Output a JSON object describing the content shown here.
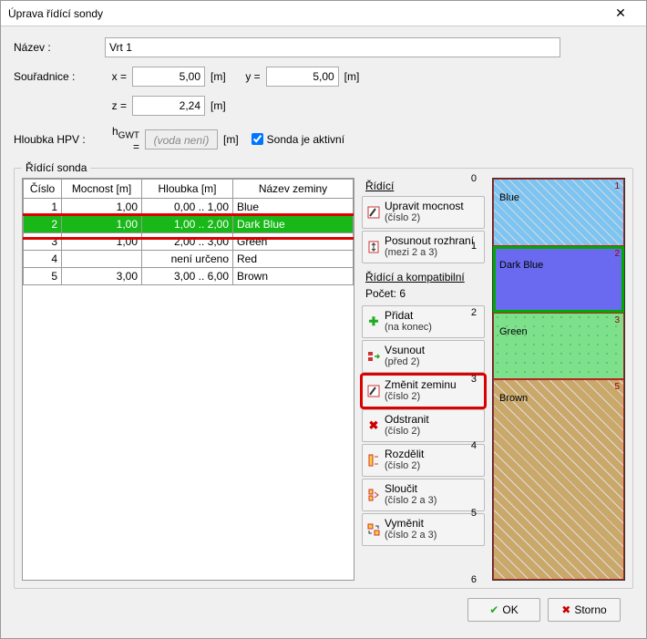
{
  "dialog": {
    "title": "Úprava řídící sondy"
  },
  "form": {
    "name_label": "Název :",
    "name_value": "Vrt 1",
    "coords_label": "Souřadnice :",
    "x_label": "x =",
    "x_value": "5,00",
    "x_unit": "[m]",
    "y_label": "y =",
    "y_value": "5,00",
    "y_unit": "[m]",
    "z_label": "z =",
    "z_value": "2,24",
    "z_unit": "[m]",
    "depth_label": "Hloubka HPV :",
    "hgwt_label": "hGWT =",
    "hgwt_placeholder": "(voda není)",
    "hgwt_unit": "[m]",
    "active_label": "Sonda je aktivní",
    "active_checked": true
  },
  "fieldset": {
    "legend": "Řídící sonda"
  },
  "table": {
    "headers": [
      "Číslo",
      "Mocnost [m]",
      "Hloubka [m]",
      "Název zeminy"
    ],
    "rows": [
      {
        "n": "1",
        "thick": "1,00",
        "depth": "0,00 .. 1,00",
        "soil": "Blue",
        "sel": false
      },
      {
        "n": "2",
        "thick": "1,00",
        "depth": "1,00 .. 2,00",
        "soil": "Dark Blue",
        "sel": true
      },
      {
        "n": "3",
        "thick": "1,00",
        "depth": "2,00 .. 3,00",
        "soil": "Green",
        "sel": false
      },
      {
        "n": "4",
        "thick": "",
        "depth": "není určeno",
        "soil": "Red",
        "sel": false
      },
      {
        "n": "5",
        "thick": "3,00",
        "depth": "3,00 .. 6,00",
        "soil": "Brown",
        "sel": false
      }
    ]
  },
  "actions": {
    "section_ridiçi": "Řídící",
    "upravit": {
      "label": "Upravit mocnost",
      "sub": "(číslo 2)"
    },
    "posunout": {
      "label": "Posunout rozhraní",
      "sub": "(mezi 2 a 3)"
    },
    "section_ridicikomp": "Řídící a kompatibilní",
    "count_label": "Počet: 6",
    "pridat": {
      "label": "Přidat",
      "sub": "(na konec)"
    },
    "vsunout": {
      "label": "Vsunout",
      "sub": "(před 2)"
    },
    "zmenit": {
      "label": "Změnit zeminu",
      "sub": "(číslo 2)"
    },
    "odstranit": {
      "label": "Odstranit",
      "sub": "(číslo 2)"
    },
    "rozdelit": {
      "label": "Rozdělit",
      "sub": "(číslo 2)"
    },
    "sloucit": {
      "label": "Sloučit",
      "sub": "(číslo 2 a 3)"
    },
    "vymenit": {
      "label": "Vyměnit",
      "sub": "(číslo 2 a 3)"
    }
  },
  "viz": {
    "scale": [
      "0",
      "1",
      "2",
      "3",
      "4",
      "5",
      "6"
    ],
    "layers": [
      {
        "n": "1",
        "name": "Blue",
        "from": 0,
        "to": 1,
        "color": "#7cc4f2",
        "hatch": "diag",
        "sel": false
      },
      {
        "n": "2",
        "name": "Dark Blue",
        "from": 1,
        "to": 2,
        "color": "#6a6af0",
        "hatch": "none",
        "sel": true
      },
      {
        "n": "3",
        "name": "Green",
        "from": 2,
        "to": 3,
        "color": "#7de08a",
        "hatch": "dots",
        "sel": false
      },
      {
        "n": "5",
        "name": "Brown",
        "from": 3,
        "to": 6,
        "color": "#c9a86a",
        "hatch": "diag2",
        "sel": false
      }
    ],
    "max": 6
  },
  "buttons": {
    "ok": "OK",
    "cancel": "Storno"
  }
}
